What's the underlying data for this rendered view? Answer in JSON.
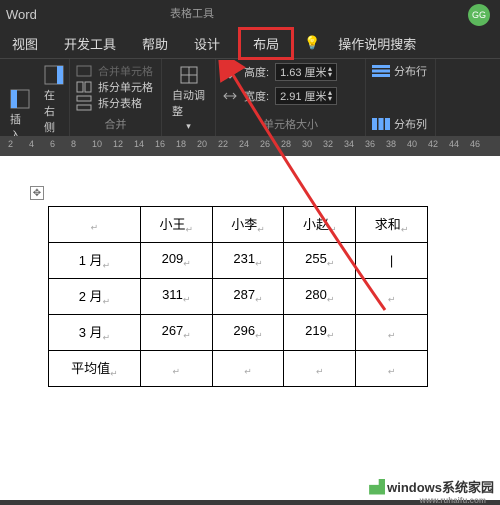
{
  "app": {
    "title": "Word",
    "tool_context": "表格工具"
  },
  "account": {
    "initial": "GG"
  },
  "tabs": {
    "view": "视图",
    "developer": "开发工具",
    "help": "帮助",
    "design": "设计",
    "layout": "布局",
    "search_prompt": "操作说明搜索"
  },
  "ribbon": {
    "insert_left": "插入",
    "insert_right": "在右侧插入",
    "merge_cells": "合并单元格",
    "split_cells": "拆分单元格",
    "split_table": "拆分表格",
    "merge_group": "合并",
    "autofit": "自动调整",
    "height_label": "高度:",
    "height_value": "1.63 厘米",
    "width_label": "宽度:",
    "width_value": "2.91 厘米",
    "size_group": "单元格大小",
    "dist_rows": "分布行",
    "dist_cols": "分布列"
  },
  "ruler": {
    "marks": [
      2,
      4,
      6,
      8,
      10,
      12,
      14,
      16,
      18,
      20,
      22,
      24,
      26,
      28,
      30,
      32,
      34,
      36,
      38,
      40,
      42,
      44,
      46
    ]
  },
  "table": {
    "headers": [
      "",
      "小王",
      "小李",
      "小赵",
      "求和"
    ],
    "rows": [
      {
        "label": "1 月",
        "cells": [
          "209",
          "231",
          "255",
          ""
        ],
        "cursor": 3
      },
      {
        "label": "2 月",
        "cells": [
          "311",
          "287",
          "280",
          ""
        ]
      },
      {
        "label": "3 月",
        "cells": [
          "267",
          "296",
          "219",
          ""
        ]
      },
      {
        "label": "平均值",
        "cells": [
          "",
          "",
          "",
          ""
        ]
      }
    ]
  },
  "watermark": {
    "main": "windows系统家园",
    "sub": "www.ruhaifu.com"
  }
}
